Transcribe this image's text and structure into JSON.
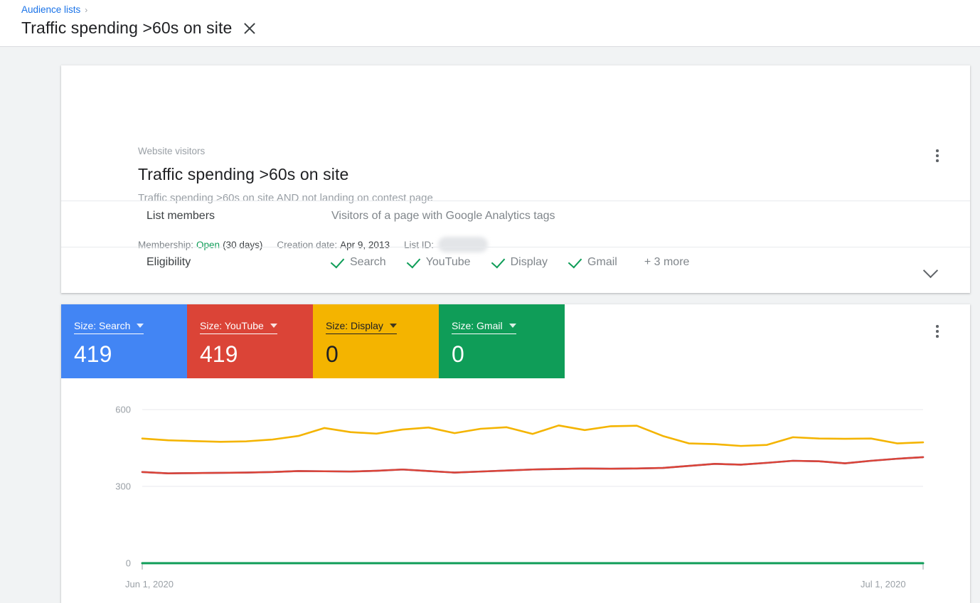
{
  "topbar": {
    "breadcrumb_label": "Audience lists",
    "breadcrumb_separator": "›",
    "page_title": "Traffic spending >60s on site",
    "close_icon": "close-icon"
  },
  "info_card": {
    "eyebrow": "Website visitors",
    "name": "Traffic spending >60s on site",
    "description": "Traffic spending >60s on site AND not landing on contest page",
    "meta": {
      "membership_label": "Membership:",
      "membership_value": "Open",
      "membership_duration": "(30 days)",
      "creation_label": "Creation date:",
      "creation_value": "Apr 9, 2013",
      "list_id_label": "List ID:",
      "list_id_value": ""
    },
    "rows": [
      {
        "label": "List members",
        "value": "Visitors of a page with Google Analytics tags"
      },
      {
        "label": "Eligibility",
        "value": ""
      }
    ],
    "eligibility": [
      {
        "label": "Search"
      },
      {
        "label": "YouTube"
      },
      {
        "label": "Display"
      },
      {
        "label": "Gmail"
      }
    ],
    "eligibility_more": "+ 3 more",
    "expand_icon": "chevron-down-icon",
    "menu_icon": "more-vert-icon"
  },
  "chart_card": {
    "menu_icon": "more-vert-icon",
    "tiles": [
      {
        "label": "Size: Search",
        "value": "419",
        "bg": "#4285F4",
        "fg": "#ffffff"
      },
      {
        "label": "Size: YouTube",
        "value": "419",
        "bg": "#DB4437",
        "fg": "#ffffff"
      },
      {
        "label": "Size: Display",
        "value": "0",
        "bg": "#F4B400",
        "fg": "#202124"
      },
      {
        "label": "Size: Gmail",
        "value": "0",
        "bg": "#0F9D58",
        "fg": "#ffffff"
      }
    ]
  },
  "chart_data": {
    "type": "line",
    "title": "",
    "xlabel": "",
    "ylabel": "",
    "grid": true,
    "legend": "none",
    "ylim": [
      0,
      600
    ],
    "yticks": [
      0,
      300,
      600
    ],
    "ytick_labels": [
      "0",
      "300",
      "600"
    ],
    "xlim": [
      "Jun 1, 2020",
      "Jul 1, 2020"
    ],
    "xtick_labels": [
      "Jun 1, 2020",
      "Jul 1, 2020"
    ],
    "x": [
      "Jun 1, 2020",
      "Jun 2, 2020",
      "Jun 3, 2020",
      "Jun 4, 2020",
      "Jun 5, 2020",
      "Jun 6, 2020",
      "Jun 7, 2020",
      "Jun 8, 2020",
      "Jun 9, 2020",
      "Jun 10, 2020",
      "Jun 11, 2020",
      "Jun 12, 2020",
      "Jun 13, 2020",
      "Jun 14, 2020",
      "Jun 15, 2020",
      "Jun 16, 2020",
      "Jun 17, 2020",
      "Jun 18, 2020",
      "Jun 19, 2020",
      "Jun 20, 2020",
      "Jun 21, 2020",
      "Jun 22, 2020",
      "Jun 23, 2020",
      "Jun 24, 2020",
      "Jun 25, 2020",
      "Jun 26, 2020",
      "Jun 27, 2020",
      "Jun 28, 2020",
      "Jun 29, 2020",
      "Jun 30, 2020",
      "Jul 1, 2020"
    ],
    "series": [
      {
        "name": "Display",
        "color": "#F4B400",
        "values": [
          487,
          480,
          477,
          474,
          476,
          483,
          497,
          528,
          512,
          506,
          522,
          530,
          508,
          525,
          531,
          505,
          538,
          520,
          535,
          537,
          497,
          468,
          465,
          458,
          462,
          492,
          487,
          486,
          487,
          468,
          472
        ]
      },
      {
        "name": "YouTube",
        "color": "#DB4437",
        "values": [
          356,
          351,
          352,
          353,
          354,
          356,
          360,
          359,
          358,
          361,
          366,
          360,
          354,
          358,
          362,
          366,
          368,
          370,
          369,
          370,
          372,
          380,
          388,
          385,
          392,
          400,
          398,
          390,
          400,
          408,
          414
        ]
      },
      {
        "name": "Search",
        "color": "#4285F4",
        "values": [
          356,
          351,
          352,
          353,
          354,
          356,
          360,
          359,
          358,
          361,
          366,
          360,
          354,
          358,
          362,
          366,
          368,
          370,
          369,
          370,
          372,
          380,
          388,
          385,
          392,
          400,
          398,
          390,
          400,
          408,
          414
        ]
      },
      {
        "name": "Gmail",
        "color": "#0F9D58",
        "values": [
          0,
          0,
          0,
          0,
          0,
          0,
          0,
          0,
          0,
          0,
          0,
          0,
          0,
          0,
          0,
          0,
          0,
          0,
          0,
          0,
          0,
          0,
          0,
          0,
          0,
          0,
          0,
          0,
          0,
          0,
          0
        ]
      }
    ]
  }
}
